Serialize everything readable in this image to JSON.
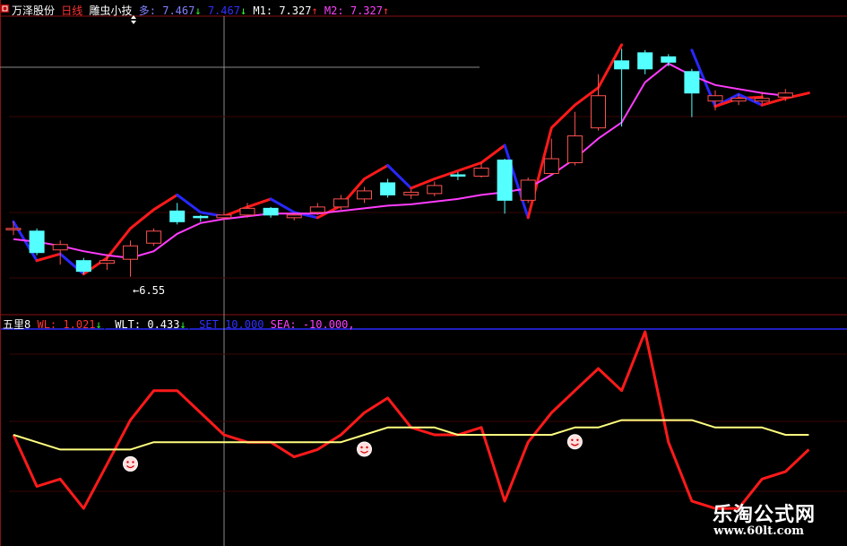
{
  "header": {
    "stock_name": "万泽股份",
    "period": "日线",
    "indicator": "雕虫小技",
    "duo_label": "多:",
    "duo_value": "7.467",
    "kong_value": "7.467",
    "m1_label": "M1:",
    "m1_value": "7.327",
    "m2_label": "M2:",
    "m2_value": "7.327"
  },
  "sub_header": {
    "name": "五里8",
    "wl_label": "WL:",
    "wl_value": "1.021",
    "wlt_label": "WLT:",
    "wlt_value": "0.433",
    "set_label": "SET",
    "set_value": "10.000",
    "sea_label": "SEA:",
    "sea_value": "-10.000,"
  },
  "low_marker": "←6.55",
  "watermark": {
    "line1": "乐淘公式网",
    "line2": "www.60lt.com"
  },
  "colors": {
    "up": "#ff5050",
    "down": "#54ffff",
    "ma": "#ff3cff",
    "line_red": "#ff1a1a",
    "line_blue": "#2828ff",
    "osc": "#ff1a1a",
    "signal": "#ffff80"
  },
  "chart_data": [
    {
      "type": "candlestick",
      "title": "万泽股份 日线",
      "ylim": [
        6.3,
        8.5
      ],
      "candles": [
        {
          "o": 6.93,
          "c": 6.93,
          "h": 6.98,
          "l": 6.88
        },
        {
          "o": 6.91,
          "c": 6.75,
          "h": 6.93,
          "l": 6.73
        },
        {
          "o": 6.77,
          "c": 6.81,
          "h": 6.84,
          "l": 6.66
        },
        {
          "o": 6.69,
          "c": 6.61,
          "h": 6.71,
          "l": 6.59
        },
        {
          "o": 6.67,
          "c": 6.69,
          "h": 6.74,
          "l": 6.62
        },
        {
          "o": 6.7,
          "c": 6.8,
          "h": 6.84,
          "l": 6.57
        },
        {
          "o": 6.82,
          "c": 6.91,
          "h": 6.93,
          "l": 6.8
        },
        {
          "o": 7.06,
          "c": 6.98,
          "h": 7.12,
          "l": 6.96
        },
        {
          "o": 7.02,
          "c": 7.01,
          "h": 7.03,
          "l": 6.98
        },
        {
          "o": 7.01,
          "c": 7.03,
          "h": 7.05,
          "l": 6.99
        },
        {
          "o": 7.03,
          "c": 7.08,
          "h": 7.12,
          "l": 7.01
        },
        {
          "o": 7.08,
          "c": 7.03,
          "h": 7.09,
          "l": 7.01
        },
        {
          "o": 7.01,
          "c": 7.03,
          "h": 7.05,
          "l": 6.99
        },
        {
          "o": 7.05,
          "c": 7.09,
          "h": 7.12,
          "l": 7.03
        },
        {
          "o": 7.09,
          "c": 7.15,
          "h": 7.18,
          "l": 7.07
        },
        {
          "o": 7.15,
          "c": 7.21,
          "h": 7.24,
          "l": 7.12
        },
        {
          "o": 7.27,
          "c": 7.18,
          "h": 7.3,
          "l": 7.16
        },
        {
          "o": 7.18,
          "c": 7.2,
          "h": 7.22,
          "l": 7.15
        },
        {
          "o": 7.19,
          "c": 7.25,
          "h": 7.28,
          "l": 7.17
        },
        {
          "o": 7.33,
          "c": 7.32,
          "h": 7.35,
          "l": 7.29
        },
        {
          "o": 7.32,
          "c": 7.38,
          "h": 7.42,
          "l": 7.31
        },
        {
          "o": 7.44,
          "c": 7.14,
          "h": 7.45,
          "l": 7.04
        },
        {
          "o": 7.14,
          "c": 7.29,
          "h": 7.31,
          "l": 7.12
        },
        {
          "o": 7.34,
          "c": 7.45,
          "h": 7.6,
          "l": 7.33
        },
        {
          "o": 7.42,
          "c": 7.62,
          "h": 7.8,
          "l": 7.4
        },
        {
          "o": 7.68,
          "c": 7.92,
          "h": 8.08,
          "l": 7.66
        },
        {
          "o": 8.18,
          "c": 8.12,
          "h": 8.27,
          "l": 7.69
        },
        {
          "o": 8.24,
          "c": 8.12,
          "h": 8.26,
          "l": 8.08
        },
        {
          "o": 8.21,
          "c": 8.17,
          "h": 8.23,
          "l": 8.14
        },
        {
          "o": 8.1,
          "c": 7.94,
          "h": 8.12,
          "l": 7.76
        },
        {
          "o": 7.88,
          "c": 7.92,
          "h": 7.96,
          "l": 7.81
        },
        {
          "o": 7.88,
          "c": 7.9,
          "h": 7.93,
          "l": 7.85
        },
        {
          "o": 7.88,
          "c": 7.9,
          "h": 7.95,
          "l": 7.86
        },
        {
          "o": 7.91,
          "c": 7.94,
          "h": 7.97,
          "l": 7.88
        }
      ],
      "ma": [
        6.85,
        6.83,
        6.8,
        6.76,
        6.73,
        6.71,
        6.76,
        6.89,
        6.97,
        7.0,
        7.02,
        7.04,
        7.04,
        7.04,
        7.06,
        7.08,
        7.1,
        7.11,
        7.13,
        7.15,
        7.18,
        7.2,
        7.23,
        7.33,
        7.45,
        7.6,
        7.72,
        8.02,
        8.16,
        8.07,
        8.0,
        7.97,
        7.94,
        7.92
      ],
      "ma_x_start": 7,
      "trail": [
        {
          "x": [
            0,
            1
          ],
          "y": [
            6.98,
            6.69
          ],
          "dir": "down"
        },
        {
          "x": [
            1,
            2
          ],
          "y": [
            6.69,
            6.74
          ],
          "dir": "up"
        },
        {
          "x": [
            2,
            3
          ],
          "y": [
            6.74,
            6.59
          ],
          "dir": "down"
        },
        {
          "x": [
            3,
            4,
            5,
            6,
            7
          ],
          "y": [
            6.59,
            6.71,
            6.93,
            7.07,
            7.18
          ],
          "dir": "up"
        },
        {
          "x": [
            7,
            8,
            9
          ],
          "y": [
            7.18,
            7.05,
            7.02
          ],
          "dir": "down"
        },
        {
          "x": [
            9,
            10,
            11
          ],
          "y": [
            7.02,
            7.09,
            7.15
          ],
          "dir": "up"
        },
        {
          "x": [
            11,
            12,
            13
          ],
          "y": [
            7.15,
            7.05,
            7.01
          ],
          "dir": "down"
        },
        {
          "x": [
            13,
            14,
            15,
            16
          ],
          "y": [
            7.01,
            7.1,
            7.3,
            7.4
          ],
          "dir": "up"
        },
        {
          "x": [
            16,
            17
          ],
          "y": [
            7.4,
            7.23
          ],
          "dir": "down"
        },
        {
          "x": [
            17,
            18,
            19,
            20,
            21
          ],
          "y": [
            7.23,
            7.3,
            7.36,
            7.42,
            7.55
          ],
          "dir": "up"
        },
        {
          "x": [
            21,
            22
          ],
          "y": [
            7.55,
            7.01
          ],
          "dir": "down"
        },
        {
          "x": [
            22,
            23,
            24,
            25,
            26
          ],
          "y": [
            7.01,
            7.68,
            7.85,
            7.98,
            8.3
          ],
          "dir": "up"
        },
        {
          "x": [
            29,
            30,
            31
          ],
          "y": [
            8.26,
            7.84,
            7.93
          ],
          "dir": "down"
        },
        {
          "x": [
            30,
            31,
            32
          ],
          "y": [
            7.84,
            7.9,
            7.91
          ],
          "dir": "up"
        },
        {
          "x": [
            31,
            32
          ],
          "y": [
            7.93,
            7.85
          ],
          "dir": "down"
        },
        {
          "x": [
            32,
            33,
            34
          ],
          "y": [
            7.85,
            7.9,
            7.94
          ],
          "dir": "up"
        }
      ]
    },
    {
      "type": "line",
      "title": "五里8",
      "ylim": [
        -14,
        14
      ],
      "series": [
        {
          "name": "WL",
          "values": [
            0,
            -7,
            -6,
            -10,
            -4,
            2,
            6,
            6,
            3,
            0,
            -1,
            -1,
            -3,
            -2,
            0,
            3,
            5,
            1,
            0,
            0,
            1,
            -9,
            -1,
            3,
            6,
            9,
            6,
            14,
            -1,
            -9,
            -10,
            -10,
            -6,
            -5,
            -2
          ]
        },
        {
          "name": "WLT",
          "values": [
            0,
            -1,
            -2,
            -2,
            -2,
            -2,
            -1,
            -1,
            -1,
            -1,
            -1,
            -1,
            -1,
            -1,
            -1,
            0,
            1,
            1,
            1,
            0,
            0,
            0,
            0,
            0,
            1,
            1,
            2,
            2,
            2,
            2,
            1,
            1,
            1,
            0,
            0
          ]
        }
      ],
      "smileys_at": [
        5,
        15,
        24
      ]
    }
  ]
}
